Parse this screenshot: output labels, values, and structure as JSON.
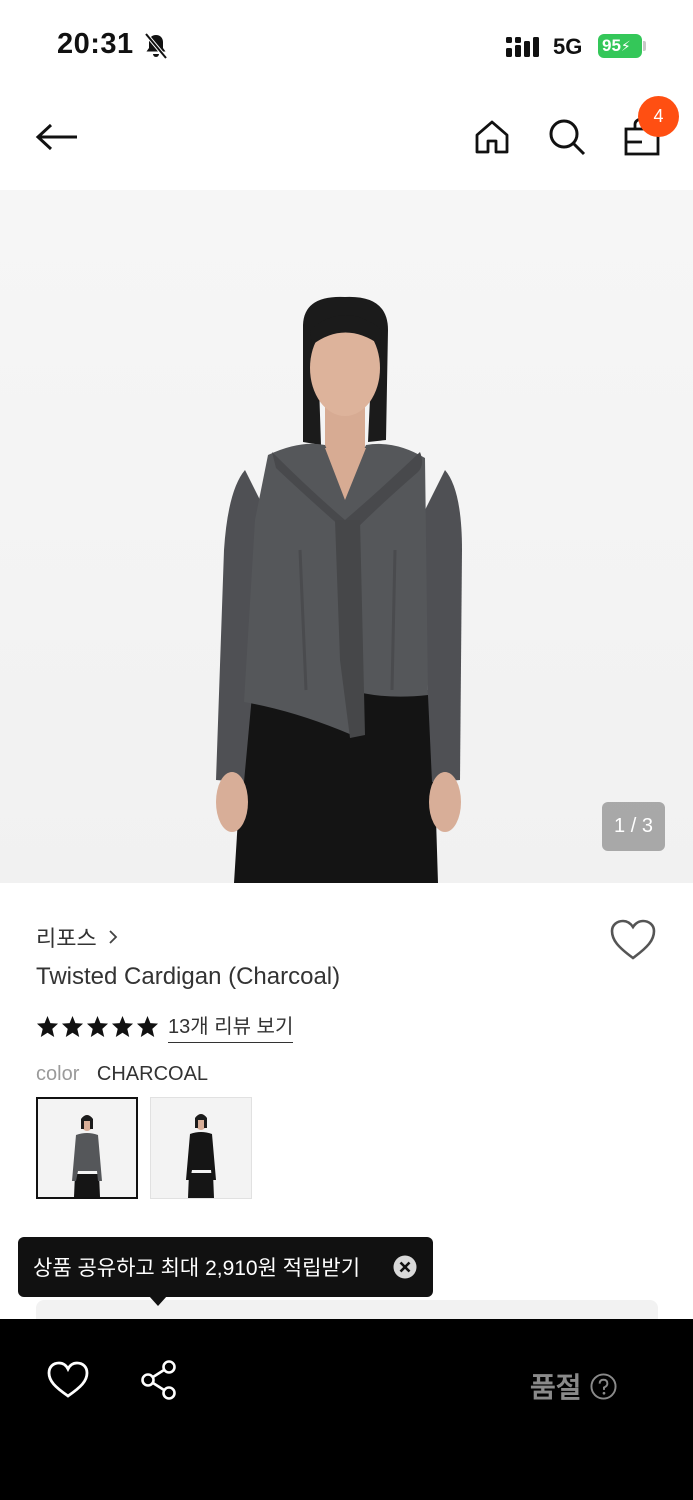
{
  "status_bar": {
    "time": "20:31",
    "network": "5G",
    "battery": "95",
    "icons": [
      "bell-off-icon",
      "signal-icon",
      "battery-charging-icon"
    ]
  },
  "header": {
    "icons": [
      "arrow-left-icon",
      "home-icon",
      "search-icon",
      "shopping-bag-icon"
    ],
    "cart_count": "4"
  },
  "gallery": {
    "counter": "1 / 3"
  },
  "product": {
    "brand": "리포스",
    "title": "Twisted Cardigan (Charcoal)",
    "rating": 5,
    "rating_max": 5,
    "review_link": "13개 리뷰 보기",
    "color_label": "color",
    "color_value": "CHARCOAL",
    "swatches": [
      {
        "name": "charcoal",
        "selected": true,
        "top_color": "#55575a"
      },
      {
        "name": "black",
        "selected": false,
        "top_color": "#151515"
      }
    ]
  },
  "tooltip": {
    "text": "상품 공유하고 최대 2,910원 적립받기"
  },
  "bottom_bar": {
    "status_label": "품절",
    "icons": [
      "heart-icon",
      "share-icon",
      "help-icon"
    ]
  },
  "colors": {
    "accent": "#ff4f12",
    "battery": "#34c759",
    "bottom_bar_bg": "#000000",
    "soldout_text": "#8a8a8a"
  }
}
